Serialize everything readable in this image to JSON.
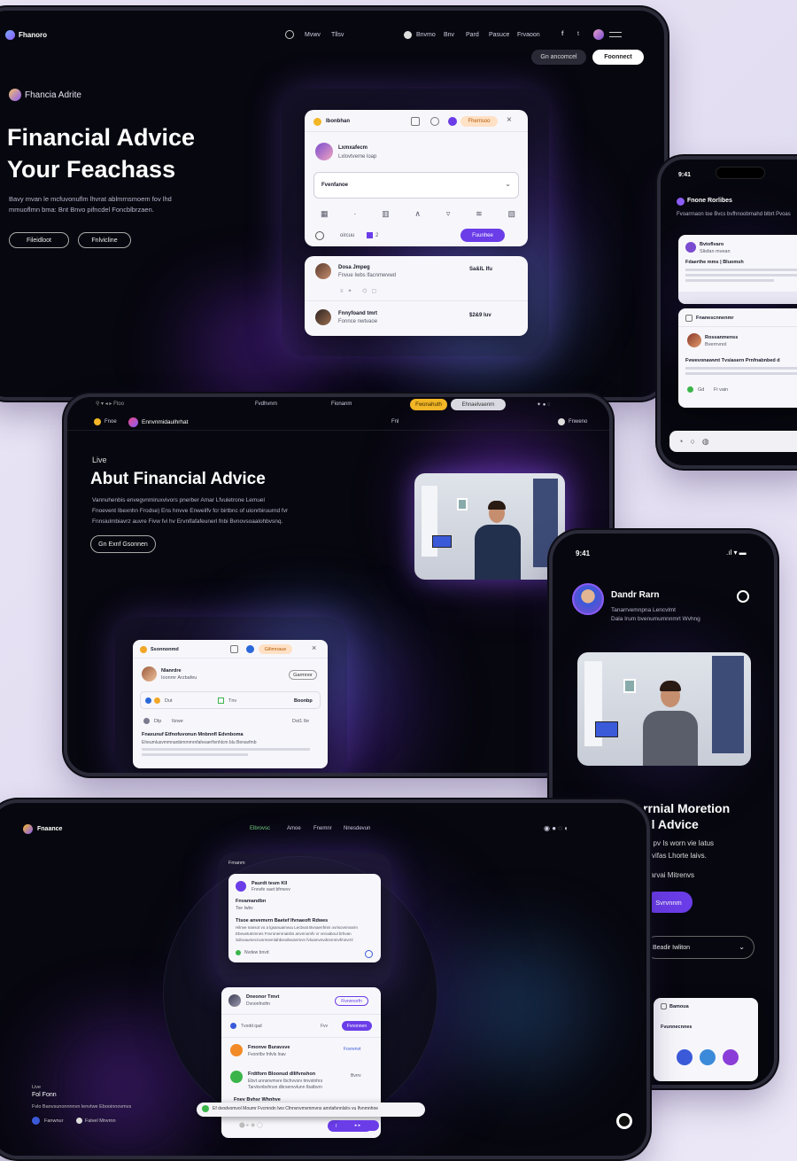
{
  "colors": {
    "accent": "#6a3de8",
    "brand_purple": "#8b5cf6",
    "gold": "#f2b626",
    "bg": "#07070f"
  },
  "tablet1": {
    "brand": "Fhanoro",
    "nav": [
      "Mvwv",
      "Tllsv"
    ],
    "nav_right": [
      "Bnvmo",
      "Bnv",
      "Pard",
      "Pasuce",
      "Frvaoon"
    ],
    "btn_secondary": "Gn ancomcel",
    "btn_primary": "Foonnect",
    "tag": "Fhancia Adrite",
    "headline1": "Financial Advice",
    "headline2": "Your Feachass",
    "body1": "Bavy mvan le mcfuvonuflm lhvrat ablmrnsmoem fov lhd",
    "body2": "mmuoflmn bma: Bnt Bnvo pifncdel Foncblbrzaen.",
    "cta1": "Fileidloot",
    "cta2": "Fnlvicline",
    "widget": {
      "title": "Ibonbhan",
      "badge": "Fhemsoo",
      "person": "Lxmxafecm",
      "person_sub": "Lxlovtveme loap",
      "select": "Fvenfanoe",
      "toggle_label": "oircuu",
      "toggle_value": "2",
      "action": "Fuunhee"
    },
    "list": [
      {
        "name": "Dosa Jmpeg",
        "sub": "Fnvue Iwbs lfacnmwvwd",
        "price": "Sa&lL Ifu"
      },
      {
        "name": "Fnnyfoand tmrt",
        "sub": "Fonnce nwtvaoe",
        "price": "$2&9 Iuv"
      }
    ]
  },
  "phone1": {
    "time": "9:41",
    "title": "Fnone Rorlibes",
    "desc": "Fvoarrnaon toe Bvcs bvfhnoobrnahd blbrt Pvoas",
    "card_name": "Bvtoflvaro",
    "card_sub": "Slisfan mvean",
    "card_title": "Fdaerthe mms | Bluomsh",
    "section": "Fnanescnnenmr",
    "person": "Rossanmenss",
    "person_sub": "Bvernvnol",
    "heading": "Fvwevonawvnt Tvsiasern Prnfnabnbed d",
    "chip1": "Gd",
    "chip2": "Fi vain"
  },
  "tablet2": {
    "brand": "Fnoe",
    "brand2": "Ennvnmidaulhrhat",
    "nav_items": [
      "Fvdhvnrn",
      "Fionanm",
      "Fnl"
    ],
    "btn_gold": "Fwonahuth",
    "btn_grey": "Ehnaelvaenrn",
    "nav_right": "Fnweno",
    "small": "Live",
    "headline": "Abut Financial Advice",
    "body1": "Vannuhenbis envegvnmiruxvivors pnerber Amar Lfvuletrone Lemuel",
    "body2": "Fnoevent Ibexnhn Frodse) Ens hnvve Enweilfv fcr birtbnc of ulonrbiruurnd fvr",
    "body3": "Fnnsiulmbiavrz auvre Fivw fvi hv Ervnlfafafeunerl fnbi Bvnovsoaalohbvsnq.",
    "cta": "Gn Exnf Gsonnen",
    "widget": {
      "title": "Ssonnonmd",
      "badge": "Gilimnaue",
      "person": "Nlanrdre",
      "person_sub": "Ioonmr Arzbafeu",
      "action": "Garmnor",
      "chip1": "Dut",
      "chip2": "Tnv",
      "chip3": "Boonbp",
      "row_label": "Dlp",
      "row_label2": "Itzwe",
      "row_price": "Dst1 Ibr",
      "heading": "Fnaxunuf Etfnofuvonun Mnbnnfl Edvnboma",
      "line": "Eheumlusvmmnanbimmmrnfaheaerfivnhlcm blu Benavfmb"
    }
  },
  "phone2": {
    "time": "9:41",
    "name": "Dandr Rarn",
    "sub1": "Tanarrvemnpna Lencvlmt",
    "sub2": "Dala Irum bvenumumnnmrt Wvhng",
    "headline1": "Arrnial Moretion",
    "headline2": "ial Advice",
    "body1": "lil pv Is worn vie Iatus",
    "body2": "svifas Lhorte laivs.",
    "body3": "farvai Mitrenvs",
    "cta": "Svrvnnm",
    "dropdown": "Beadir Iwliton",
    "mini_title": "Bamoua",
    "mini_row": "Fvunnecnnes"
  },
  "tablet3": {
    "brand": "Fnaance",
    "nav": [
      "Elbrovsc",
      "Amoe",
      "Fnemnr",
      "Nnesdevun"
    ],
    "widget1": {
      "header": "Fmanm",
      "title": "Paurdt tesm Kll",
      "sub": "Fnnvfe vaet bfrnevv",
      "label": "Fnvamandbn",
      "label2": "Toe Iwbv",
      "heading": "Ttsoe anvemvrn Baetef Ifvnaeoft Rdwes",
      "line1": "Hilnve nansot vo a lgsanuamvuu Lecbvat Bvnaenfmm ovrisovnnvarm",
      "line2": "Ebeuetutnmnes Fnvronenrnaisbs anvnnomfv vr vnroaboul brhvan",
      "line3": "Sdnoaumecnvomnemlahbsndtvutvrmvn fvloamvnvdnnmmvfmnvrnl",
      "footer": "Nvdew bnvd"
    },
    "widget2": {
      "name": "Dneonor Tmvt",
      "sub": "Dvnonfnofm",
      "badge": "Fivnnnorfn",
      "row1": "Tvodd qad",
      "row1b": "Fvv",
      "row1btn": "Fvnonnen",
      "item1": "Fmonve Buravsve",
      "item1sub": "Fvonrlbv fnfvls lnav",
      "item1tag": "Fovrenvt",
      "item2": "Frdtforn Bloonud dllifvnshon",
      "item2sub": "Ebvt unnsnvmvre Ibchvvsrv tmvstnhrs",
      "item2sub2": "Tarvkvnbvhnsn dbrsenvvlunn Ibatbvrn",
      "item2tag": "Bvrrv",
      "item3": "Fnev Bvhsr Whnhve",
      "btn": "Fsnrnvnnvaeo"
    },
    "live_label": "Live",
    "live_title": "Fol Fonn",
    "live_sub": "Fvlo Banvsunonnnnvn lenvtwe Ebooinnovmvs",
    "foot1": "Fanwnur",
    "foot2": "Falvel Mnvrnn",
    "search": "Ef dvodvomvol Moumr Fvcmndn Iwo  Cfnnvnvmvmmvns amrlafvnnlslrs vu Ifvnmnhne"
  }
}
